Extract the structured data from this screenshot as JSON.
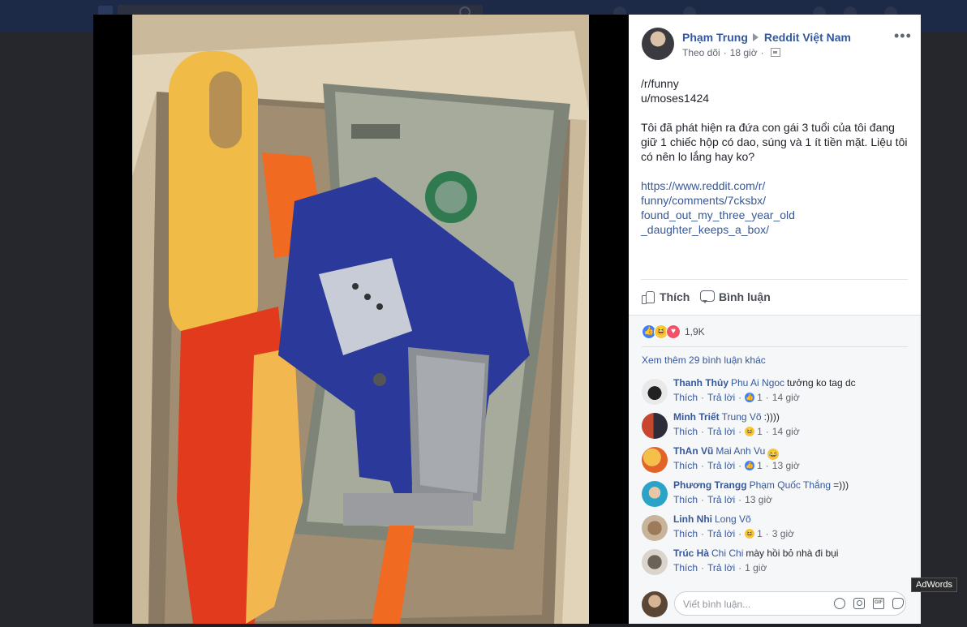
{
  "post": {
    "author": "Phạm Trung",
    "group": "Reddit Việt Nam",
    "follow_label": "Theo dõi",
    "time": "18 giờ",
    "more": "•••",
    "text_source": "/r/funny\nu/moses1424",
    "text_body": "Tôi đã phát hiện ra đứa con gái 3 tuổi của tôi đang giữ 1 chiếc hộp có dao, súng và 1 ít tiền mặt. Liệu tôi có nên lo lắng hay ko?",
    "link": "https://www.reddit.com/r/\nfunny/comments/7cksbx/\nfound_out_my_three_year_old\n_daughter_keeps_a_box/"
  },
  "actions": {
    "like": "Thích",
    "comment": "Bình luận"
  },
  "reactions": {
    "count": "1,9K",
    "types": [
      "like-icon",
      "haha-icon",
      "love-icon"
    ]
  },
  "view_more": "Xem thêm 29 bình luận khác",
  "comments": [
    {
      "author": "Thanh Thủy",
      "tag": "Phu Ai Ngoc",
      "text": "tưởng ko tag dc",
      "like": "Thích",
      "reply": "Trả lời",
      "reaction": "like",
      "reaction_count": "1",
      "time": "14 giờ"
    },
    {
      "author": "Minh Triết",
      "tag": "Trung Võ",
      "text": ":))))",
      "like": "Thích",
      "reply": "Trả lời",
      "reaction": "haha",
      "reaction_count": "1",
      "time": "14 giờ"
    },
    {
      "author": "ThAn Vũ",
      "tag": "Mai Anh Vu",
      "text": "",
      "emoji": "😂",
      "like": "Thích",
      "reply": "Trả lời",
      "reaction": "like",
      "reaction_count": "1",
      "time": "13 giờ"
    },
    {
      "author": "Phương Trangg",
      "tag": "Phạm Quốc Thắng",
      "text": "=)))",
      "like": "Thích",
      "reply": "Trả lời",
      "reaction": "",
      "reaction_count": "",
      "time": "13 giờ"
    },
    {
      "author": "Linh Nhi",
      "tag": "Long Võ",
      "text": "",
      "like": "Thích",
      "reply": "Trả lời",
      "reaction": "haha",
      "reaction_count": "1",
      "time": "3 giờ"
    },
    {
      "author": "Trúc Hà",
      "tag": "Chi Chi",
      "text": "mày hồi bỏ nhà đi bụi",
      "like": "Thích",
      "reply": "Trả lời",
      "reaction": "",
      "reaction_count": "",
      "time": "1 giờ"
    }
  ],
  "write_comment": {
    "placeholder": "Viết bình luận..."
  },
  "tooltip": "AdWords",
  "colors": {
    "link": "#365899",
    "overlay": "#000000",
    "topbar": "#1c2a47"
  }
}
